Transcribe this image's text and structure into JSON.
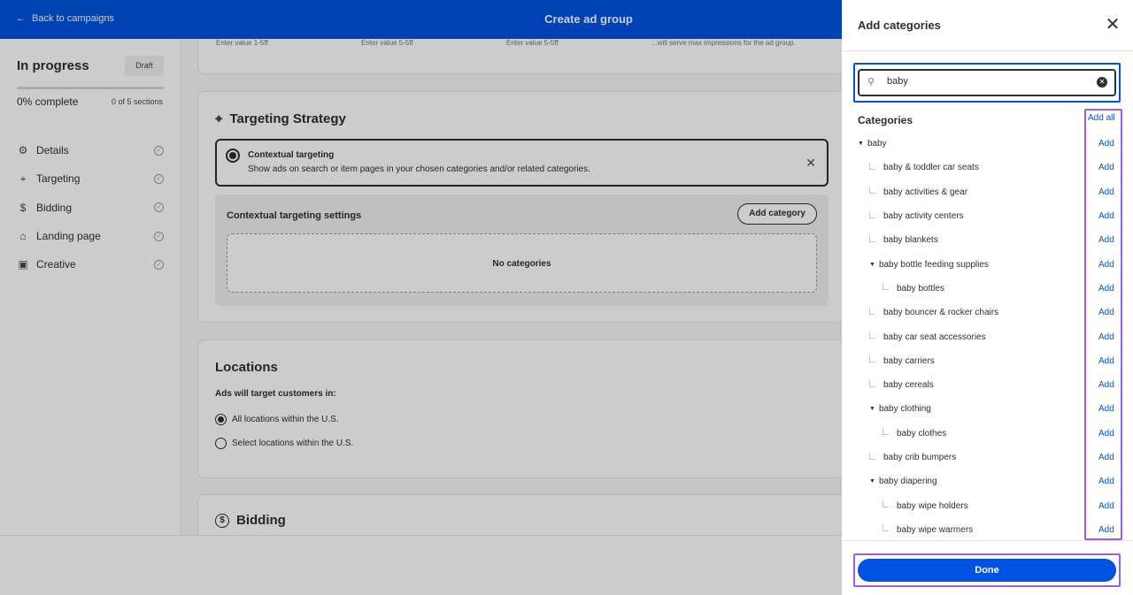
{
  "topbar": {
    "back_label": "Back to campaigns",
    "title": "Create ad group"
  },
  "sidebar": {
    "status": "In progress",
    "draft_badge": "Draft",
    "progress_pct": 0,
    "pct_label": "0% complete",
    "sections_label": "0 of 5 sections",
    "items": [
      {
        "label": "Details",
        "icon": "gear-icon"
      },
      {
        "label": "Targeting",
        "icon": "target-icon"
      },
      {
        "label": "Bidding",
        "icon": "dollar-icon"
      },
      {
        "label": "Landing page",
        "icon": "home-icon"
      },
      {
        "label": "Creative",
        "icon": "image-icon"
      }
    ]
  },
  "main": {
    "top_card": {
      "values": [
        "Enter value 1-5ff",
        "Enter value 5-5ff",
        "Enter value 5-5ff",
        "...will serve max impressions for the ad group."
      ]
    },
    "targeting": {
      "title": "Targeting Strategy",
      "option_title": "Contextual targeting",
      "option_desc": "Show ads on search or item pages in your chosen categories and/or related categories.",
      "settings_label": "Contextual targeting settings",
      "add_category": "Add category",
      "no_categories": "No categories"
    },
    "locations": {
      "title": "Locations",
      "subtitle": "Ads will target customers in:",
      "options": [
        "All locations within the U.S.",
        "Select locations within the U.S."
      ]
    },
    "bidding": {
      "title": "Bidding"
    }
  },
  "panel": {
    "title": "Add categories",
    "search_value": "baby",
    "categories_label": "Categories",
    "add_all": "Add all",
    "add_label": "Add",
    "done": "Done",
    "tree": [
      {
        "label": "baby",
        "level": 0,
        "expanded": true
      },
      {
        "label": "baby & toddler car seats",
        "level": 1
      },
      {
        "label": "baby activities & gear",
        "level": 1
      },
      {
        "label": "baby activity centers",
        "level": 1
      },
      {
        "label": "baby blankets",
        "level": 1
      },
      {
        "label": "baby bottle feeding supplies",
        "level": 1,
        "expanded": true
      },
      {
        "label": "baby bottles",
        "level": 2
      },
      {
        "label": "baby bouncer & rocker chairs",
        "level": 1
      },
      {
        "label": "baby car seat accessories",
        "level": 1
      },
      {
        "label": "baby carriers",
        "level": 1
      },
      {
        "label": "baby cereals",
        "level": 1
      },
      {
        "label": "baby clothing",
        "level": 1,
        "expanded": true
      },
      {
        "label": "baby clothes",
        "level": 2
      },
      {
        "label": "baby crib bumpers",
        "level": 1
      },
      {
        "label": "baby diapering",
        "level": 1,
        "expanded": true
      },
      {
        "label": "baby wipe holders",
        "level": 2
      },
      {
        "label": "baby wipe warmers",
        "level": 2
      }
    ]
  },
  "colors": {
    "brand_blue": "#0053e2",
    "highlight_purple": "#9b5de5",
    "text": "#2e2f32"
  }
}
